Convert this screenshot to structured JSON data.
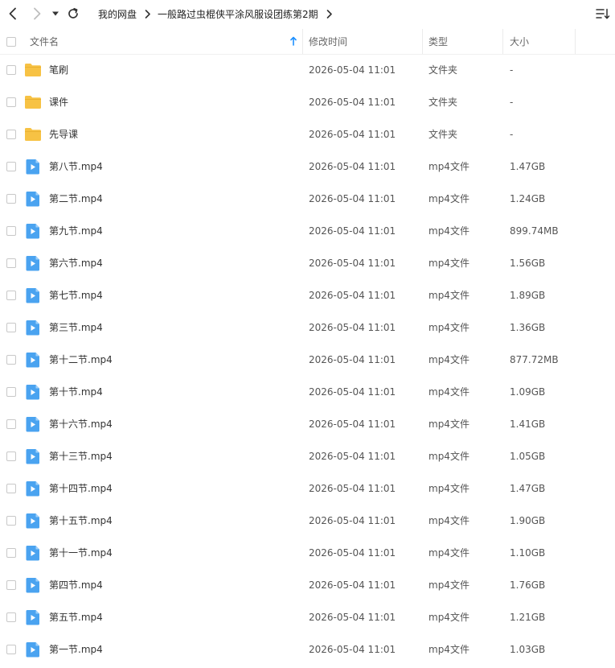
{
  "toolbar": {
    "breadcrumb": [
      {
        "label": "我的网盘"
      },
      {
        "label": "一般路过虫棍侠平涂风服设团练第2期"
      }
    ]
  },
  "header": {
    "name": "文件名",
    "modified": "修改时间",
    "type": "类型",
    "size": "大小"
  },
  "colors": {
    "folder": "#f7c244",
    "video": "#4aa3f0",
    "sort_arrow": "#1e90ff"
  },
  "files": [
    {
      "name": "笔刷",
      "modified": "2026-05-04 11:01",
      "type": "文件夹",
      "size": "-",
      "icon": "folder-icon"
    },
    {
      "name": "课件",
      "modified": "2026-05-04 11:01",
      "type": "文件夹",
      "size": "-",
      "icon": "folder-icon"
    },
    {
      "name": "先导课",
      "modified": "2026-05-04 11:01",
      "type": "文件夹",
      "size": "-",
      "icon": "folder-icon"
    },
    {
      "name": "第八节.mp4",
      "modified": "2026-05-04 11:01",
      "type": "mp4文件",
      "size": "1.47GB",
      "icon": "video-file-icon"
    },
    {
      "name": "第二节.mp4",
      "modified": "2026-05-04 11:01",
      "type": "mp4文件",
      "size": "1.24GB",
      "icon": "video-file-icon"
    },
    {
      "name": "第九节.mp4",
      "modified": "2026-05-04 11:01",
      "type": "mp4文件",
      "size": "899.74MB",
      "icon": "video-file-icon"
    },
    {
      "name": "第六节.mp4",
      "modified": "2026-05-04 11:01",
      "type": "mp4文件",
      "size": "1.56GB",
      "icon": "video-file-icon"
    },
    {
      "name": "第七节.mp4",
      "modified": "2026-05-04 11:01",
      "type": "mp4文件",
      "size": "1.89GB",
      "icon": "video-file-icon"
    },
    {
      "name": "第三节.mp4",
      "modified": "2026-05-04 11:01",
      "type": "mp4文件",
      "size": "1.36GB",
      "icon": "video-file-icon"
    },
    {
      "name": "第十二节.mp4",
      "modified": "2026-05-04 11:01",
      "type": "mp4文件",
      "size": "877.72MB",
      "icon": "video-file-icon"
    },
    {
      "name": "第十节.mp4",
      "modified": "2026-05-04 11:01",
      "type": "mp4文件",
      "size": "1.09GB",
      "icon": "video-file-icon"
    },
    {
      "name": "第十六节.mp4",
      "modified": "2026-05-04 11:01",
      "type": "mp4文件",
      "size": "1.41GB",
      "icon": "video-file-icon"
    },
    {
      "name": "第十三节.mp4",
      "modified": "2026-05-04 11:01",
      "type": "mp4文件",
      "size": "1.05GB",
      "icon": "video-file-icon"
    },
    {
      "name": "第十四节.mp4",
      "modified": "2026-05-04 11:01",
      "type": "mp4文件",
      "size": "1.47GB",
      "icon": "video-file-icon"
    },
    {
      "name": "第十五节.mp4",
      "modified": "2026-05-04 11:01",
      "type": "mp4文件",
      "size": "1.90GB",
      "icon": "video-file-icon"
    },
    {
      "name": "第十一节.mp4",
      "modified": "2026-05-04 11:01",
      "type": "mp4文件",
      "size": "1.10GB",
      "icon": "video-file-icon"
    },
    {
      "name": "第四节.mp4",
      "modified": "2026-05-04 11:01",
      "type": "mp4文件",
      "size": "1.76GB",
      "icon": "video-file-icon"
    },
    {
      "name": "第五节.mp4",
      "modified": "2026-05-04 11:01",
      "type": "mp4文件",
      "size": "1.21GB",
      "icon": "video-file-icon"
    },
    {
      "name": "第一节.mp4",
      "modified": "2026-05-04 11:01",
      "type": "mp4文件",
      "size": "1.03GB",
      "icon": "video-file-icon"
    }
  ]
}
